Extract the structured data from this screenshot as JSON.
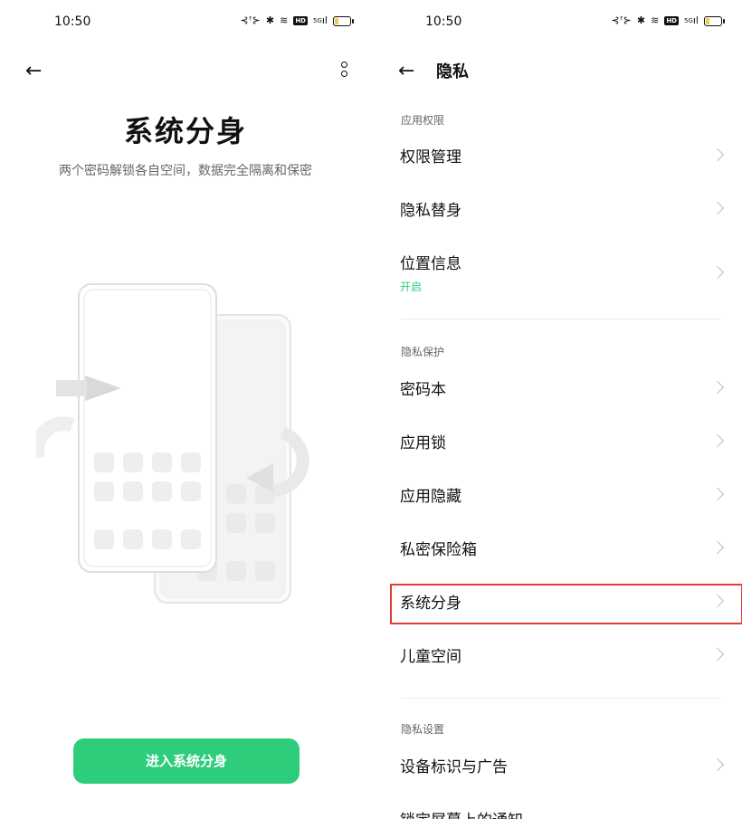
{
  "left_panel": {
    "status": {
      "time": "10:50",
      "network": "5G"
    },
    "hero_title": "系统分身",
    "hero_subtitle": "两个密码解锁各自空间，数据完全隔离和保密",
    "enter_button": "进入系统分身"
  },
  "right_panel": {
    "status": {
      "time": "10:50",
      "network": "5G"
    },
    "title": "隐私",
    "sections": [
      {
        "label": "应用权限",
        "items": [
          {
            "label": "权限管理"
          },
          {
            "label": "隐私替身"
          },
          {
            "label": "位置信息",
            "sub": "开启"
          }
        ]
      },
      {
        "label": "隐私保护",
        "items": [
          {
            "label": "密码本"
          },
          {
            "label": "应用锁"
          },
          {
            "label": "应用隐藏"
          },
          {
            "label": "私密保险箱"
          },
          {
            "label": "系统分身",
            "highlighted": true
          },
          {
            "label": "儿童空间"
          }
        ]
      },
      {
        "label": "隐私设置",
        "items": [
          {
            "label": "设备标识与广告"
          },
          {
            "label": "锁定屏幕上的通知"
          }
        ]
      }
    ]
  },
  "colors": {
    "accent_green": "#2dcd7c",
    "highlight_red": "#e53935"
  },
  "icons": [
    "back-arrow-icon",
    "more-vertical-icon",
    "chevron-right-icon",
    "wifi-icon",
    "bluetooth-icon",
    "battery-icon",
    "hd-icon",
    "signal-icon",
    "vibrate-icon"
  ]
}
